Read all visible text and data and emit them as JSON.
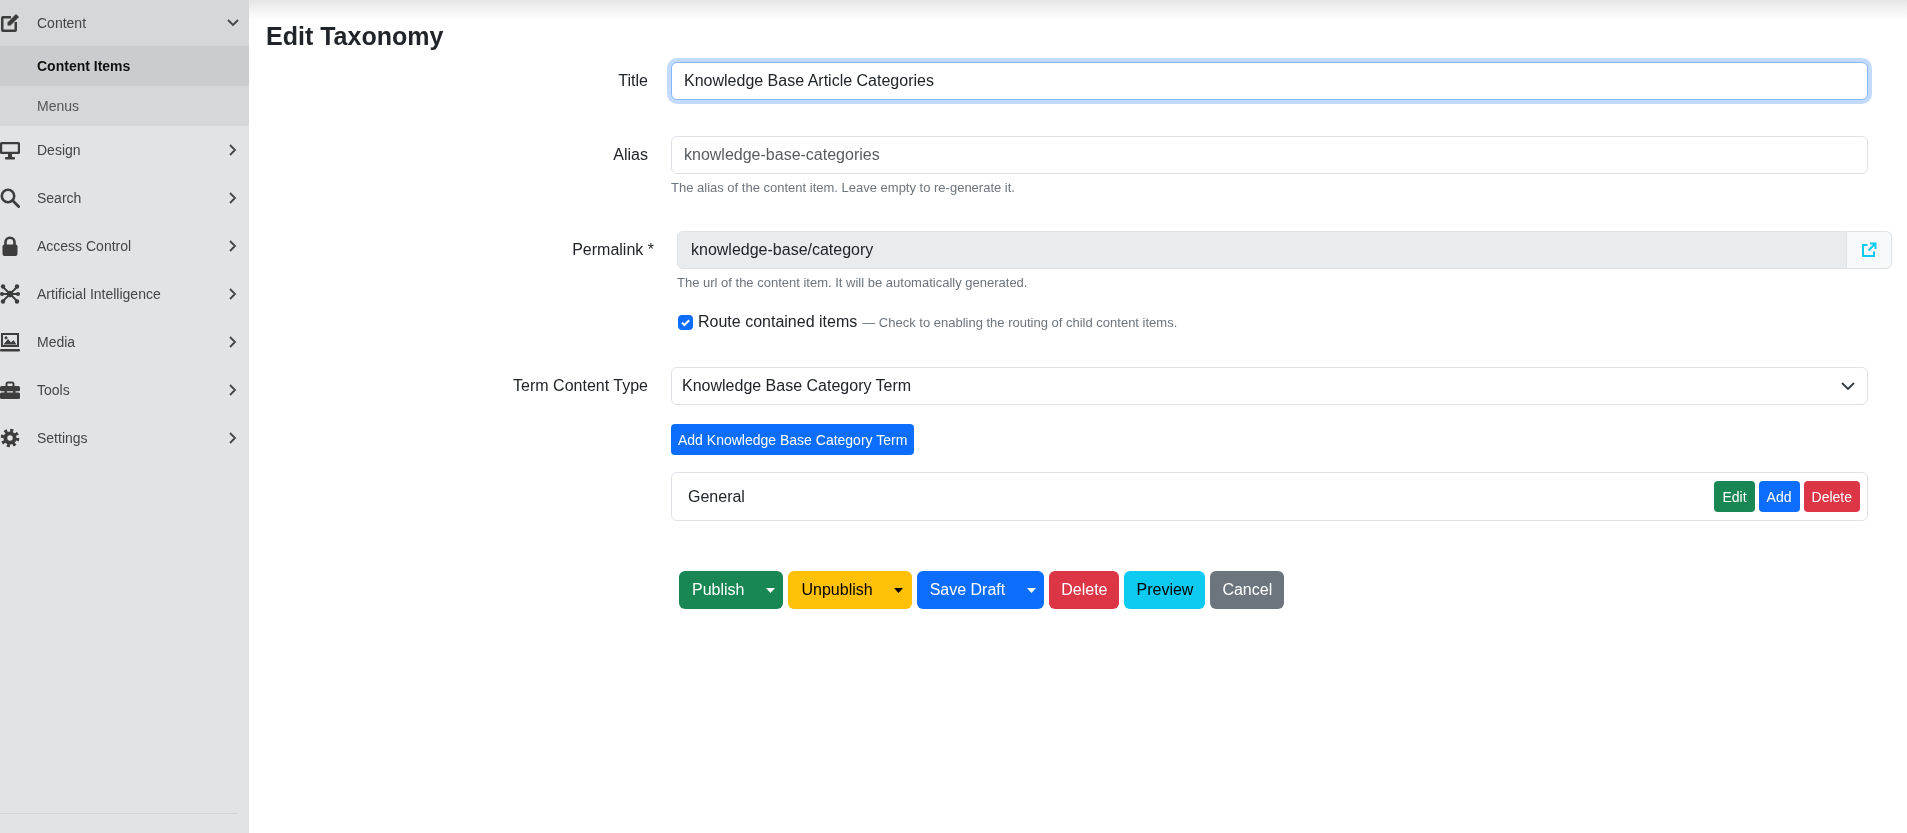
{
  "sidebar": {
    "items": [
      {
        "label": "Content",
        "expanded": true,
        "children": [
          {
            "label": "Content Items",
            "selected": true
          },
          {
            "label": "Menus",
            "selected": false
          }
        ]
      },
      {
        "label": "Design",
        "expanded": false
      },
      {
        "label": "Search",
        "expanded": false
      },
      {
        "label": "Access Control",
        "expanded": false
      },
      {
        "label": "Artificial Intelligence",
        "expanded": false
      },
      {
        "label": "Media",
        "expanded": false
      },
      {
        "label": "Tools",
        "expanded": false
      },
      {
        "label": "Settings",
        "expanded": false
      }
    ]
  },
  "page": {
    "title": "Edit Taxonomy"
  },
  "form": {
    "fields": [
      {
        "kind": "text",
        "label": "Title",
        "value": "Knowledge Base Article Categories",
        "focused": true
      },
      {
        "kind": "text",
        "label": "Alias",
        "placeholder": "knowledge-base-categories",
        "focused": false,
        "help": "The alias of the content item. Leave empty to re-generate it."
      },
      {
        "kind": "permalink",
        "label": "Permalink *",
        "value": "knowledge-base/category",
        "help": "The url of the content item. It will be automatically generated."
      },
      {
        "kind": "checkbox",
        "label": "Route contained items",
        "hint": "— Check to enabling the routing of child content items.",
        "checked": true
      },
      {
        "kind": "select",
        "label": "Term Content Type",
        "value": "Knowledge Base Category Term"
      }
    ]
  },
  "terms": {
    "add_button": "Add Knowledge Base Category Term",
    "items": [
      {
        "name": "General",
        "actions": [
          {
            "label": "Edit",
            "kind": "success"
          },
          {
            "label": "Add",
            "kind": "primary"
          },
          {
            "label": "Delete",
            "kind": "danger"
          }
        ]
      }
    ]
  },
  "actions": [
    {
      "label": "Publish",
      "kind": "success",
      "split": true
    },
    {
      "label": "Unpublish",
      "kind": "warning",
      "split": true
    },
    {
      "label": "Save Draft",
      "kind": "primary",
      "split": true
    },
    {
      "label": "Delete",
      "kind": "danger",
      "split": false
    },
    {
      "label": "Preview",
      "kind": "info",
      "split": false
    },
    {
      "label": "Cancel",
      "kind": "secondary",
      "split": false
    }
  ]
}
